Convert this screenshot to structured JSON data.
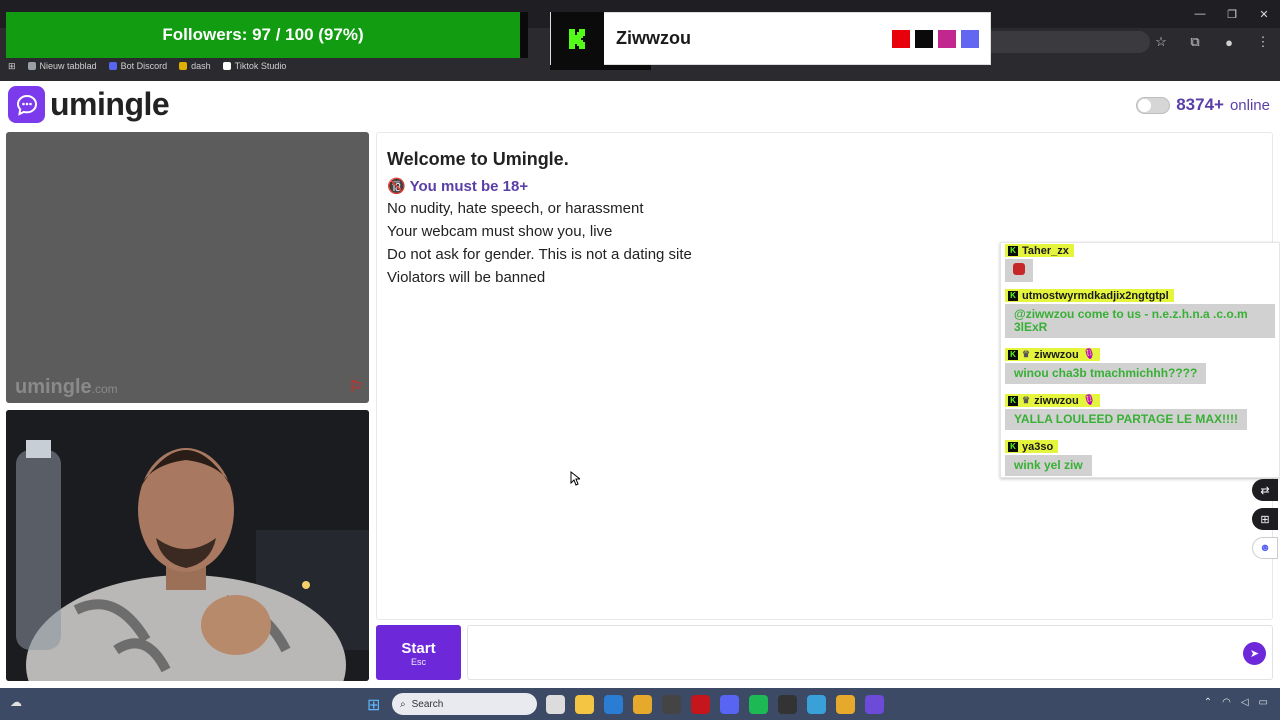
{
  "bookmarks": [
    {
      "label": "Nieuw tabblad",
      "color": "#9aa0a6"
    },
    {
      "label": "Bot Discord",
      "color": "#5865f2"
    },
    {
      "label": "dash",
      "color": "#e0b000"
    },
    {
      "label": "Tiktok Studio",
      "color": "#ffffff"
    }
  ],
  "overlay": {
    "followers_label": "Followers: 97 / 100 (97%)",
    "followers_progress": 0.97,
    "streamer_name": "Ziwwzou",
    "swatches": [
      "#e8000b",
      "#0a0a0a",
      "#c2268f",
      "#6366f1"
    ]
  },
  "header": {
    "logo_text": "umingle",
    "online_count": "8374+",
    "online_label": "online"
  },
  "video": {
    "watermark": "umingle",
    "watermark_suffix": ".com"
  },
  "welcome": {
    "title": "Welcome to Umingle.",
    "age_rule": "You must be 18+",
    "rules": [
      "No nudity, hate speech, or harassment",
      "Your webcam must show you, live",
      "Do not ask for gender. This is not a dating site",
      "Violators will be banned"
    ]
  },
  "kick_chat": [
    {
      "user": "Taher_zx",
      "text": "",
      "emoji": "devil-face"
    },
    {
      "user": "utmostwyrmdkadjix2ngtgtpl",
      "text": "@ziwwzou come to us - n.e.z.h.n.a .c.o.m 3lExR"
    },
    {
      "user": "ziwwzou",
      "text": "winou cha3b tmachmichhh????",
      "badges": [
        "crown",
        "mic"
      ]
    },
    {
      "user": "ziwwzou",
      "text": "YALLA LOULEED PARTAGE LE MAX!!!!",
      "badges": [
        "crown",
        "mic"
      ]
    },
    {
      "user": "ya3so",
      "text": "wink yel ziw"
    }
  ],
  "controls": {
    "start_label": "Start",
    "start_hint": "Esc",
    "message_placeholder": ""
  },
  "taskbar": {
    "search_label": "Search"
  },
  "colors": {
    "accent": "#6d28d9",
    "followers_bg": "#119c11",
    "kick_green": "#53fc18",
    "chat_text": "#38b035"
  }
}
